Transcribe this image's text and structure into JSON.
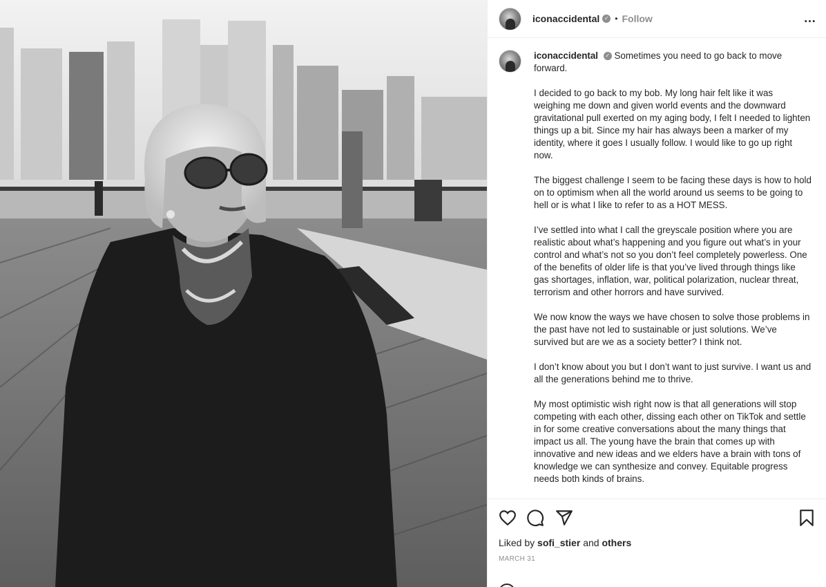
{
  "post": {
    "username": "iconaccidental",
    "follow_label": "Follow",
    "separator": "•",
    "more_icon": "…"
  },
  "caption": {
    "username": "iconaccidental",
    "paragraphs": [
      "Sometimes you need to go back to move forward.",
      "I decided to go back to my bob. My long hair felt like it was weighing me down and given world events and the downward gravitational pull exerted on my aging body, I felt I needed to lighten things up a bit. Since my hair has always been a marker of my identity, where it goes I usually follow. I would like to go up right now.",
      "The biggest challenge I seem to be facing these days is how to hold on to optimism when all the world around us seems to be going to hell or is what I like to refer to as a HOT MESS.",
      "I’ve settled into what I call the greyscale position where you are realistic about what’s happening and you figure out what’s in your control and what’s not so you don’t feel completely powerless. One of the benefits of older life is that you’ve lived through things like gas shortages, inflation, war, political polarization, nuclear threat, terrorism and other horrors and have survived.",
      "We now know the ways we have chosen to solve those problems in the past have not led to sustainable or just solutions. We’ve survived but are we as a society better? I think not.",
      "I don’t know about you but I don’t want to just survive. I want us and all the generations behind me to thrive.",
      "My most optimistic wish right now is that all generations will stop competing with each other, dissing each other on TikTok and settle in for some creative conversations about the many things that impact us all. The young have the brain that comes up with innovative and new ideas and we elders have a brain with tons of knowledge we can synthesize and convey. Equitable progress needs both kinds of brains."
    ]
  },
  "engagement": {
    "liked_by_prefix": "Liked by",
    "liked_by_user": "sofi_stier",
    "and_label": "and",
    "others_label": "others",
    "date": "MARCH 31"
  },
  "icons": {
    "like": "heart-icon",
    "comment": "comment-icon",
    "share": "share-icon",
    "save": "bookmark-icon",
    "verified": "verified-badge-icon"
  }
}
